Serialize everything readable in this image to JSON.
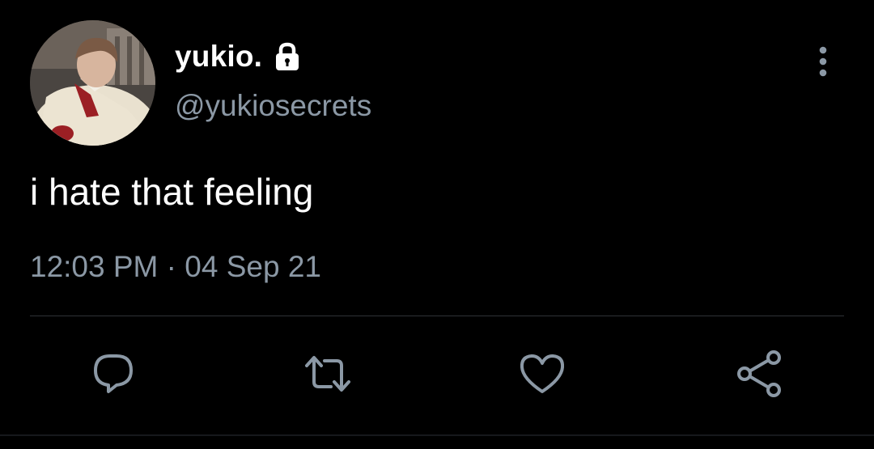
{
  "tweet": {
    "display_name": "yukio.",
    "handle": "@yukiosecrets",
    "text": "i hate that feeling",
    "time": "12:03 PM",
    "separator": "·",
    "date": "04 Sep 21"
  },
  "icons": {
    "lock": "lock-icon",
    "more": "more-vertical-icon",
    "reply": "reply-icon",
    "retweet": "retweet-icon",
    "like": "heart-icon",
    "share": "share-icon"
  },
  "colors": {
    "background": "#000000",
    "primary_text": "#ffffff",
    "secondary_text": "#8b98a5",
    "divider": "#2f3336"
  }
}
